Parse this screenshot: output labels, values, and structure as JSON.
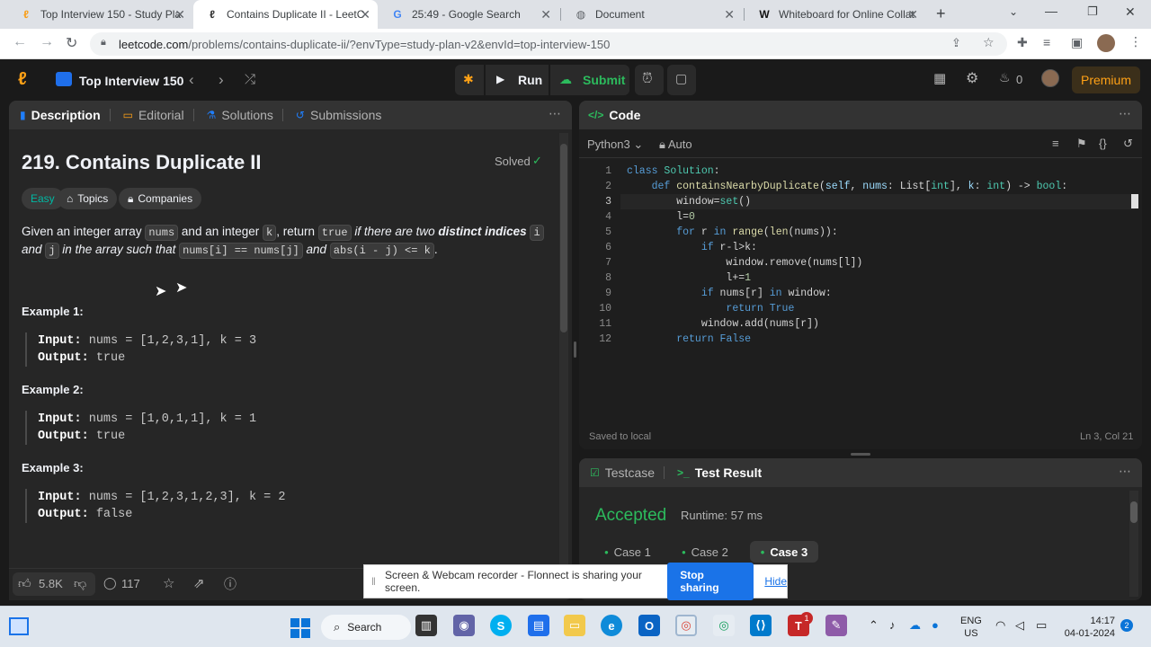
{
  "browser": {
    "tabs": [
      {
        "title": "Top Interview 150 - Study Pla",
        "icon": "leetcode-icon"
      },
      {
        "title": "Contains Duplicate II - LeetC",
        "icon": "leetcode-icon"
      },
      {
        "title": "25:49 - Google Search",
        "icon": "google-icon"
      },
      {
        "title": "Document",
        "icon": "globe-icon"
      },
      {
        "title": "Whiteboard for Online Collat",
        "icon": "w-icon"
      }
    ],
    "url_host": "leetcode.com",
    "url_path": "/problems/contains-duplicate-ii/?envType=study-plan-v2&envId=top-interview-150"
  },
  "nav": {
    "list_title": "Top Interview 150",
    "run_label": "Run",
    "submit_label": "Submit",
    "streak_count": "0",
    "premium_label": "Premium"
  },
  "left_panel": {
    "tabs": [
      "Description",
      "Editorial",
      "Solutions",
      "Submissions"
    ],
    "problem_title": "219. Contains Duplicate II",
    "solved_label": "Solved",
    "tags": [
      "Easy",
      "Topics",
      "Companies"
    ],
    "desc": {
      "p1": "Given an integer array",
      "c_nums": "nums",
      "p2": "and an integer",
      "c_k": "k",
      "p3": ", return",
      "c_true": "true",
      "p4": "if there are two",
      "p5": "distinct indices",
      "c_i": "i",
      "p6": "and",
      "c_j": "j",
      "p7": "in the array such that",
      "c_eq": "nums[i] == nums[j]",
      "p8": "and",
      "c_abs": "abs(i - j) <= k",
      "p9": "."
    },
    "examples": [
      {
        "heading": "Example 1:",
        "input": "nums = [1,2,3,1], k = 3",
        "output": "true"
      },
      {
        "heading": "Example 2:",
        "input": "nums = [1,0,1,1], k = 1",
        "output": "true"
      },
      {
        "heading": "Example 3:",
        "input": "nums = [1,2,3,1,2,3], k = 2",
        "output": "false"
      }
    ],
    "input_label": "Input:",
    "output_label": "Output:",
    "likes": "5.8K",
    "comments": "117"
  },
  "code_panel": {
    "title": "Code",
    "language": "Python3",
    "mode": "Auto",
    "saved": "Saved to local",
    "cursor": "Ln 3, Col 21",
    "line_numbers": [
      "1",
      "2",
      "3",
      "4",
      "5",
      "6",
      "7",
      "8",
      "9",
      "10",
      "11",
      "12"
    ]
  },
  "result_panel": {
    "tab_testcase": "Testcase",
    "tab_result": "Test Result",
    "status": "Accepted",
    "runtime": "Runtime: 57 ms",
    "cases": [
      "Case 1",
      "Case 2",
      "Case 3"
    ]
  },
  "share_banner": {
    "text": "Screen & Webcam recorder - Flonnect is sharing your screen.",
    "stop_label": "Stop sharing",
    "hide_label": "Hide"
  },
  "taskbar": {
    "search_label": "Search",
    "lang1": "ENG",
    "lang2": "US",
    "time": "14:17",
    "date": "04-01-2024",
    "notif": "2",
    "badge": "1"
  },
  "colors": {
    "accent_orange": "#ffa116",
    "easy": "#00b8a3",
    "accepted": "#2cbb5d",
    "blue": "#0a84ff"
  }
}
